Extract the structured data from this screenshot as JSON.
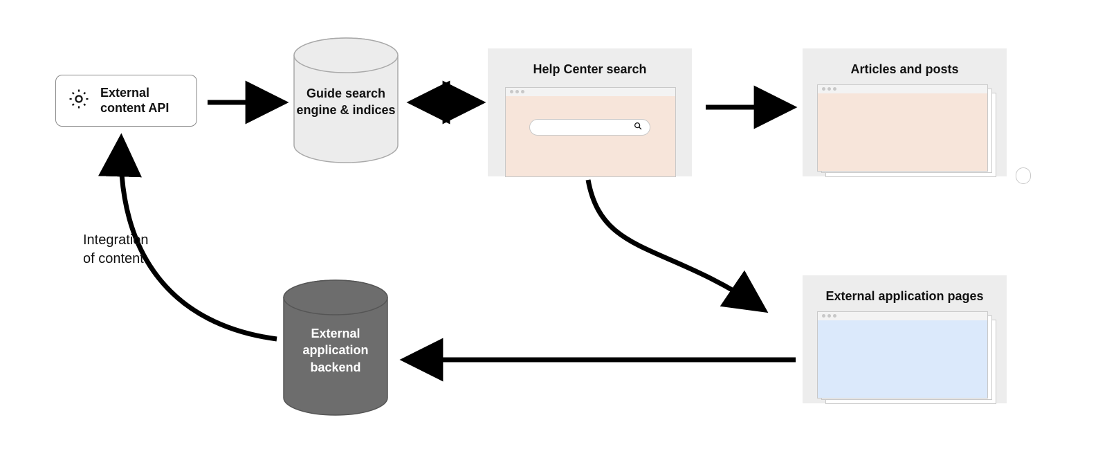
{
  "nodes": {
    "api": {
      "label": "External\ncontent API"
    },
    "searchdb": {
      "label": "Guide search\nengine & indices"
    },
    "helpcenter": {
      "label": "Help Center search"
    },
    "articles": {
      "label": "Articles and posts"
    },
    "extbackend": {
      "label": "External\napplication\nbackend"
    },
    "extpages": {
      "label": "External application pages"
    }
  },
  "edges": {
    "integration": {
      "label": "Integration\nof content"
    }
  },
  "colors": {
    "panel": "#ededed",
    "peach": "#f7e5da",
    "blue": "#dbe9fb",
    "db_light_fill": "#ececec",
    "db_light_stroke": "#a9a9a9",
    "db_dark_fill": "#6d6d6d",
    "db_dark_stroke": "#555555",
    "arrow": "#000000"
  }
}
